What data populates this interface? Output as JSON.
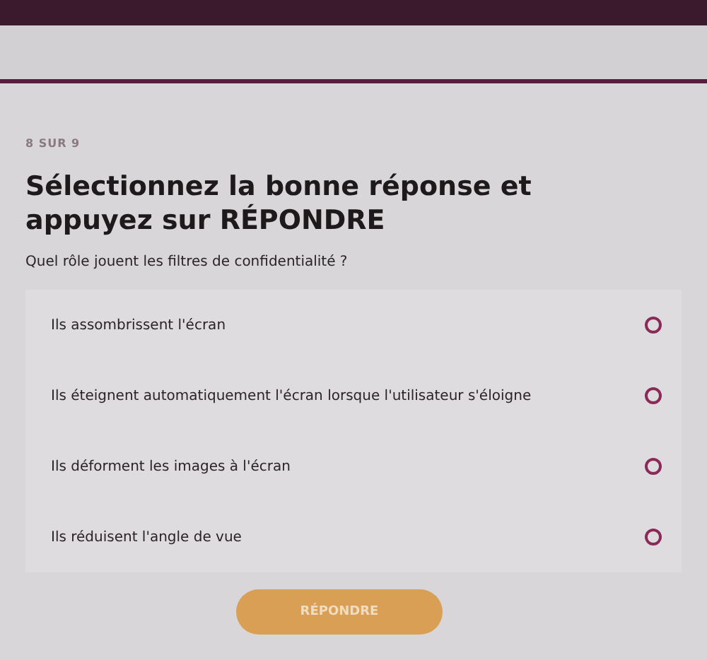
{
  "progress": "8 SUR 9",
  "title": "Sélectionnez la bonne réponse et appuyez sur RÉPONDRE",
  "question": "Quel rôle jouent les filtres de confidentialité ?",
  "options": [
    {
      "label": "Ils assombrissent l'écran",
      "selected": false
    },
    {
      "label": "Ils éteignent automatiquement l'écran lorsque l'utilisateur s'éloigne",
      "selected": false
    },
    {
      "label": "Ils déforment les images à l'écran",
      "selected": false
    },
    {
      "label": "Ils réduisent l'angle de vue",
      "selected": false
    }
  ],
  "submit": {
    "label": "RÉPONDRE",
    "disabled": true
  }
}
